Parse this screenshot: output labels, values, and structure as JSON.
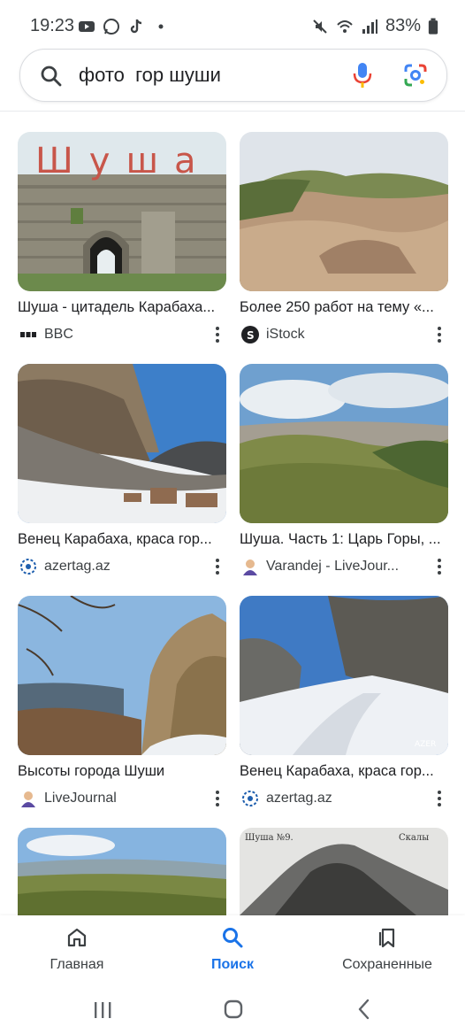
{
  "status": {
    "time": "19:23",
    "battery": "83%"
  },
  "search": {
    "query": "фото  гор шуши"
  },
  "results": [
    {
      "title": "Шуша - цитадель Карабаха...",
      "source": "BBC"
    },
    {
      "title": "Более 250 работ на тему «...",
      "source": "iStock"
    },
    {
      "title": "Венец Карабаха, краса гор...",
      "source": "azertag.az"
    },
    {
      "title": "Шуша. Часть 1: Царь Горы, ...",
      "source": "Varandej - LiveJour..."
    },
    {
      "title": "Высоты города Шуши",
      "source": "LiveJournal"
    },
    {
      "title": "Венец Карабаха, краса гор...",
      "source": "azertag.az"
    }
  ],
  "thumb_text": {
    "shusha_sign": "Шуша",
    "postcard_left": "Шуша №9.",
    "postcard_right": "Скалы",
    "watermark": "AZER"
  },
  "bottom_nav": [
    {
      "label": "Главная",
      "icon": "home-icon",
      "active": false
    },
    {
      "label": "Поиск",
      "icon": "search-icon",
      "active": true
    },
    {
      "label": "Сохраненные",
      "icon": "bookmarks-icon",
      "active": false
    }
  ],
  "colors": {
    "accent": "#1a73e8",
    "text": "#202124",
    "secondary": "#3c4043"
  }
}
